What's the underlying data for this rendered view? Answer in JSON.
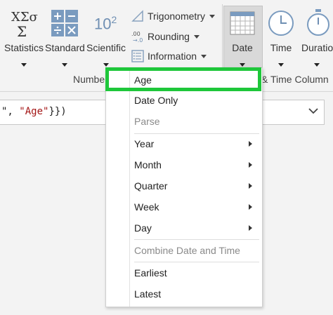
{
  "ribbon": {
    "statistics": {
      "label": "Statistics"
    },
    "standard": {
      "label": "Standard"
    },
    "scientific": {
      "label": "Scientific",
      "glyph_base": "10",
      "glyph_exp": "2"
    },
    "statistics_glyph": {
      "top": "XΣσ",
      "bottom": "Σ"
    },
    "trigonometry": {
      "label": "Trigonometry"
    },
    "rounding": {
      "label": "Rounding"
    },
    "information": {
      "label": "Information"
    },
    "date": {
      "label": "Date"
    },
    "time": {
      "label": "Time"
    },
    "duration": {
      "label": "Duratio"
    },
    "group_number": "Numbe",
    "group_datetime": "& Time Column"
  },
  "formula": {
    "prefix": "\", ",
    "string": "\"Age\"",
    "suffix": "}})"
  },
  "menu": {
    "items": [
      {
        "label": "Age"
      },
      {
        "label": "Date Only"
      },
      {
        "label": "Parse"
      },
      {
        "label": "Year"
      },
      {
        "label": "Month"
      },
      {
        "label": "Quarter"
      },
      {
        "label": "Week"
      },
      {
        "label": "Day"
      },
      {
        "label": "Combine Date and Time"
      },
      {
        "label": "Earliest"
      },
      {
        "label": "Latest"
      }
    ],
    "selected": "Age"
  },
  "colors": {
    "highlight": "#1ec73a",
    "icon_blue": "#7a9bbf",
    "string": "#a31515"
  }
}
